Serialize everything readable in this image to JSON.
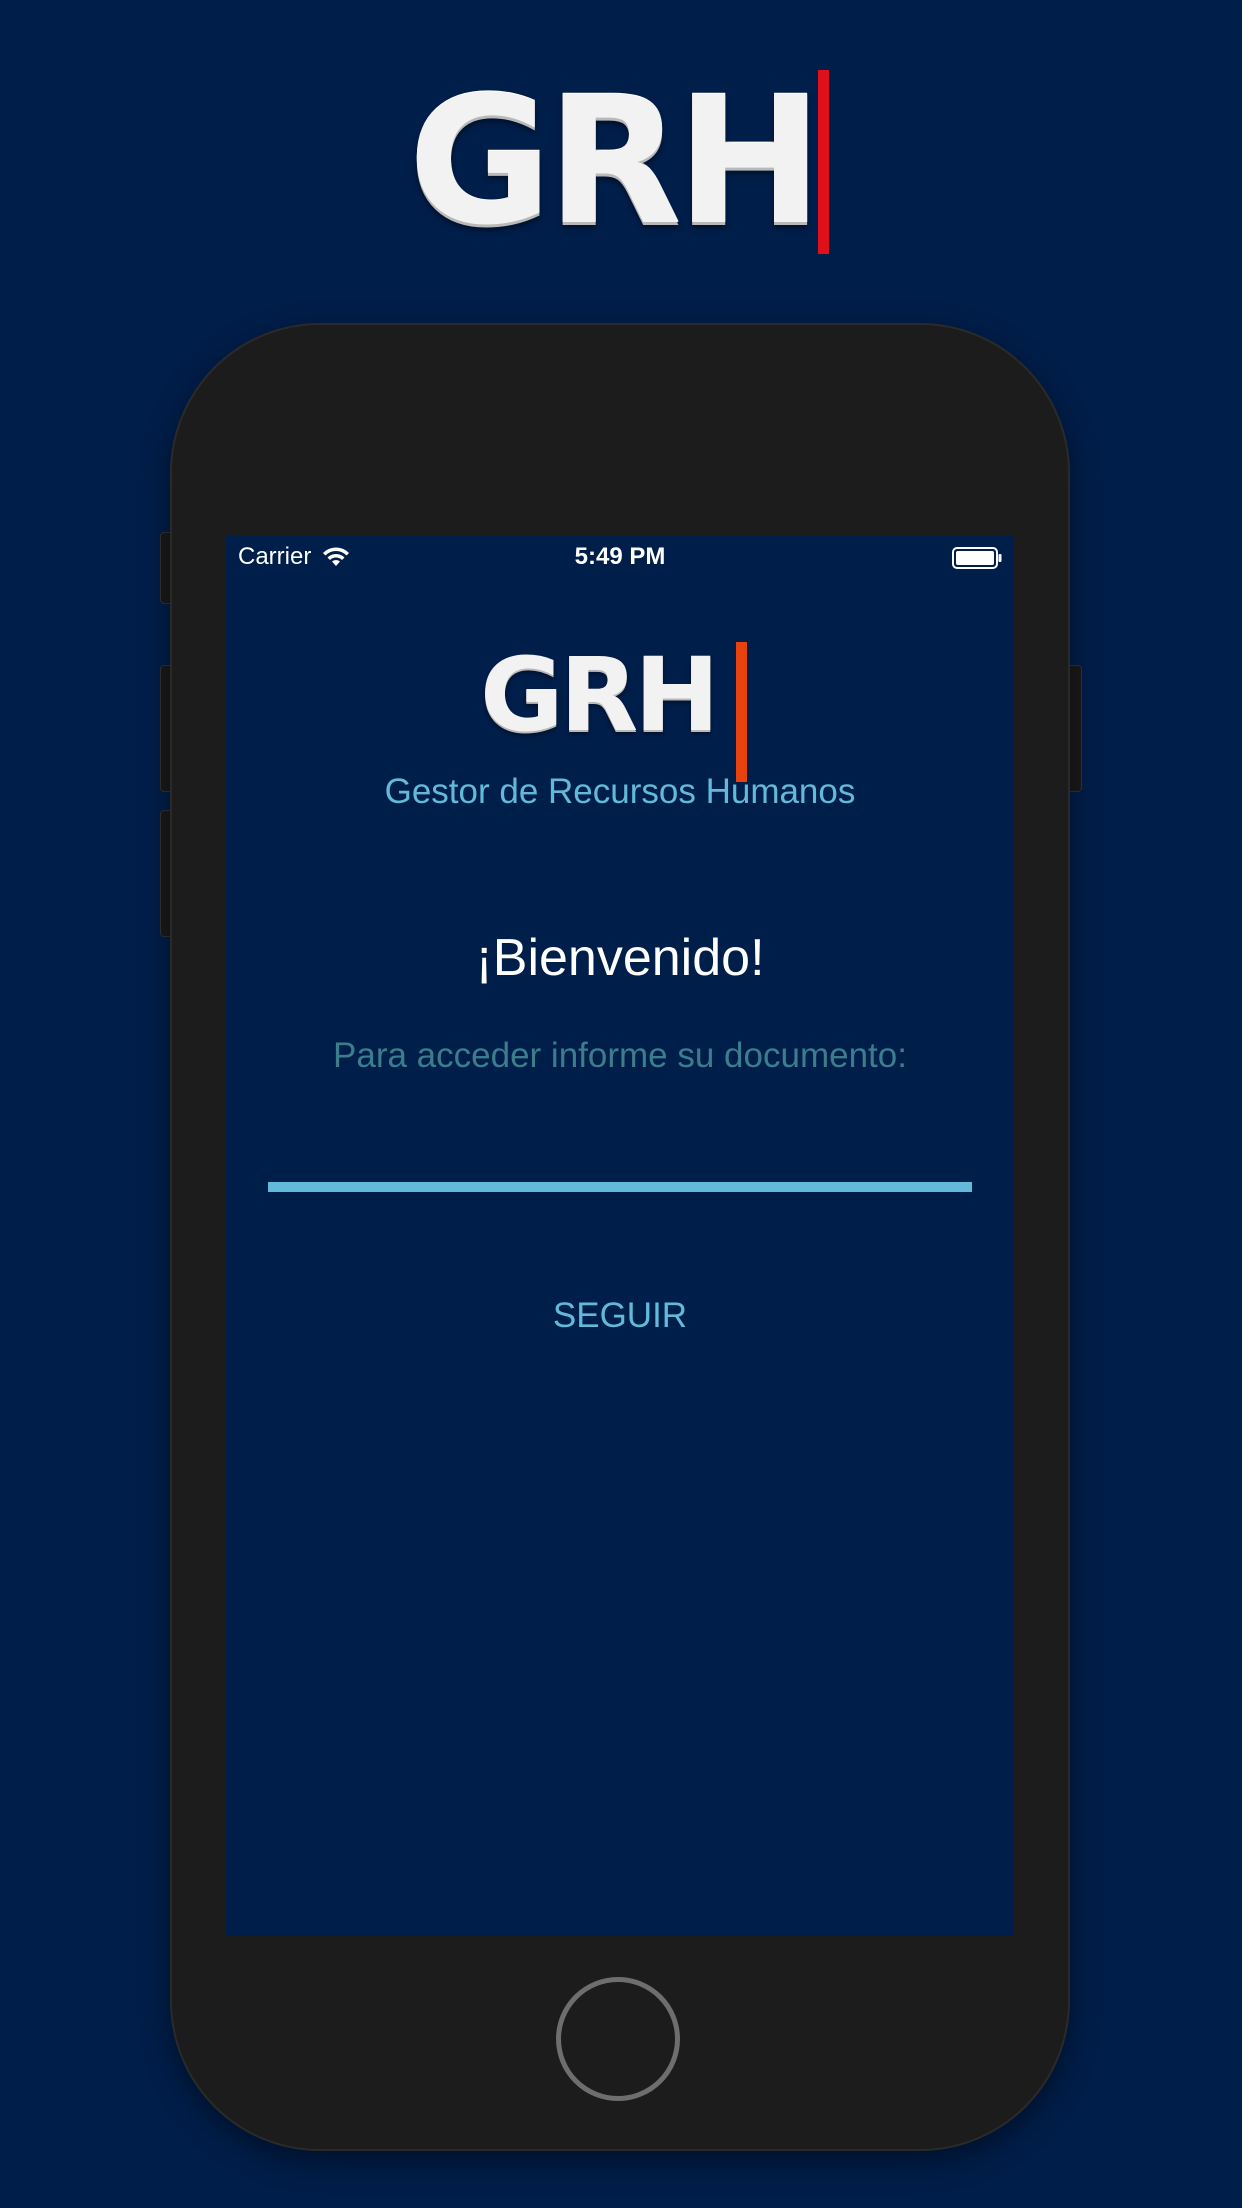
{
  "promo_logo": {
    "text": "GRH",
    "bar_color": "#e0101a"
  },
  "status_bar": {
    "carrier": "Carrier",
    "time": "5:49 PM",
    "wifi_icon": "wifi-icon",
    "battery_icon": "battery-full-icon"
  },
  "app": {
    "logo_text": "GRH",
    "logo_bar_color": "#e8420e",
    "subtitle": "Gestor de Recursos Humanos",
    "welcome": "¡Bienvenido!",
    "prompt": "Para acceder informe su documento:",
    "document_input": {
      "value": "",
      "placeholder": ""
    },
    "continue_label": "SEGUIR"
  },
  "colors": {
    "background": "#001e4a",
    "accent": "#63b9da",
    "prompt_text": "#3b7d8c",
    "phone_body": "#1c1c1c"
  }
}
